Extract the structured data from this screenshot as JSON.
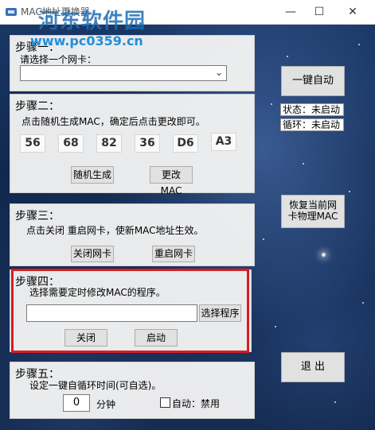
{
  "window": {
    "title": "MAC地址更换器"
  },
  "watermark": {
    "logo": "河东软件园",
    "url": "www.pc0359.cn"
  },
  "step1": {
    "title": "步骤一：",
    "prompt": "请选择一个网卡：",
    "adapter_value": ""
  },
  "step2": {
    "title": "步骤二：",
    "instruction": "点击随机生成MAC，确定后点击更改即可。",
    "mac_octets": [
      "56",
      "68",
      "82",
      "36",
      "D6",
      "A3"
    ],
    "random_button": "随机生成",
    "change_button": "更改 MAC"
  },
  "step3": {
    "title": "步骤三：",
    "instruction": "点击关闭 重启网卡，使新MAC地址生效。",
    "close_button": "关闭网卡",
    "restart_button": "重启网卡"
  },
  "step4": {
    "title": "步骤四：",
    "instruction": "选择需要定时修改MAC的程序。",
    "program_path": "",
    "select_button": "选择程序",
    "close_button": "关闭",
    "start_button": "启动"
  },
  "step5": {
    "title": "步骤五：",
    "instruction": "设定一键自循环时间(可自选)。",
    "minutes_value": "0",
    "minutes_unit": "分钟",
    "auto_label": "自动：禁用"
  },
  "right": {
    "one_click_button": "一键自动",
    "status_text": "状态：未启动",
    "loop_text": "循环：未启动",
    "restore_line1": "恢复当前网",
    "restore_line2": "卡物理MAC",
    "exit_button": "退 出"
  },
  "colors": {
    "highlight": "#d81c22",
    "watermark": "#1f6fb3"
  }
}
